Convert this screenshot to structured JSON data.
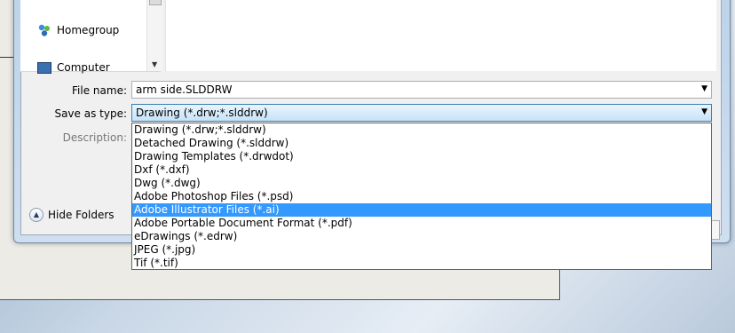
{
  "nav": {
    "homegroup_label": "Homegroup",
    "computer_label": "Computer"
  },
  "form": {
    "file_name_label": "File name:",
    "file_name_value": "arm side.SLDDRW",
    "save_as_type_label": "Save as type:",
    "save_as_type_value": "Drawing (*.drw;*.slddrw)",
    "description_label": "Description:"
  },
  "dropdown": {
    "options": [
      "Drawing (*.drw;*.slddrw)",
      "Detached Drawing (*.slddrw)",
      "Drawing Templates (*.drwdot)",
      "Dxf (*.dxf)",
      "Dwg (*.dwg)",
      "Adobe Photoshop Files (*.psd)",
      "Adobe Illustrator Files (*.ai)",
      "Adobe Portable Document Format (*.pdf)",
      "eDrawings (*.edrw)",
      "JPEG (*.jpg)",
      "Tif (*.tif)"
    ],
    "highlighted": "Adobe Illustrator Files (*.ai)"
  },
  "footer": {
    "hide_folders_label": "Hide Folders"
  },
  "icons": {
    "homegroup": "homegroup-icon",
    "computer": "computer-icon",
    "hide_folders": "chevron-up-icon",
    "dropdown": "chevron-down-icon"
  }
}
